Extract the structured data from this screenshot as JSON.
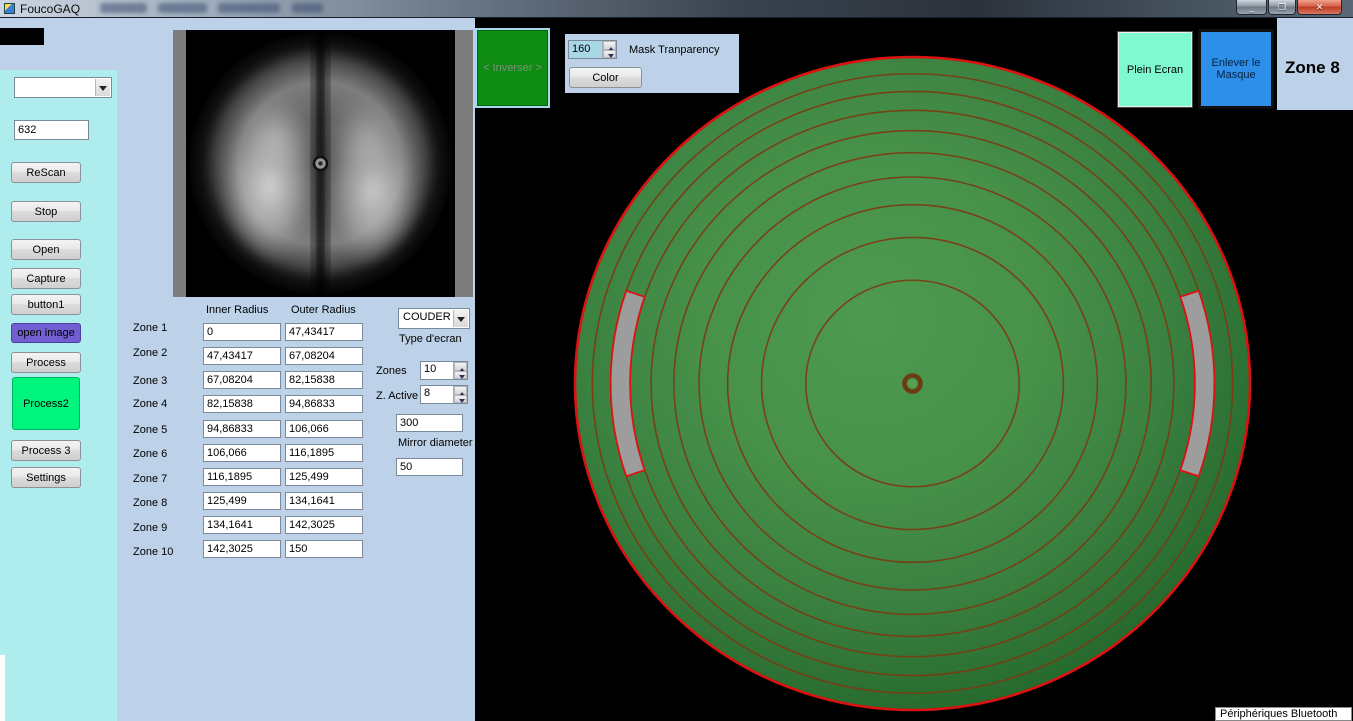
{
  "window": {
    "title": "FoucoGAQ",
    "controls": {
      "minimize": "_",
      "restore": "❐",
      "close": "✕"
    }
  },
  "sidebar": {
    "combo_value": "",
    "wavelength_value": "632",
    "buttons": [
      {
        "label": "ReScan"
      },
      {
        "label": "Stop"
      },
      {
        "label": "Open"
      },
      {
        "label": "Capture"
      },
      {
        "label": "button1"
      },
      {
        "label": "open image"
      },
      {
        "label": "Process"
      },
      {
        "label": "Process2"
      },
      {
        "label": "Process 3"
      },
      {
        "label": "Settings"
      }
    ]
  },
  "zones_table": {
    "headers": {
      "inner": "Inner Radius",
      "outer": "Outer Radius"
    },
    "rows": [
      {
        "label": "Zone 1",
        "inner": "0",
        "outer": "47,43417"
      },
      {
        "label": "Zone 2",
        "inner": "47,43417",
        "outer": "67,08204"
      },
      {
        "label": "Zone 3",
        "inner": "67,08204",
        "outer": "82,15838"
      },
      {
        "label": "Zone 4",
        "inner": "82,15838",
        "outer": "94,86833"
      },
      {
        "label": "Zone 5",
        "inner": "94,86833",
        "outer": "106,066"
      },
      {
        "label": "Zone 6",
        "inner": "106,066",
        "outer": "116,1895"
      },
      {
        "label": "Zone 7",
        "inner": "116,1895",
        "outer": "125,499"
      },
      {
        "label": "Zone 8",
        "inner": "125,499",
        "outer": "134,1641"
      },
      {
        "label": "Zone 9",
        "inner": "134,1641",
        "outer": "142,3025"
      },
      {
        "label": "Zone 10",
        "inner": "142,3025",
        "outer": "150"
      }
    ]
  },
  "screen_controls": {
    "screen_type_value": "COUDER",
    "screen_type_label": "Type d'ecran",
    "zones_label": "Zones",
    "zones_value": "10",
    "z_active_label": "Z. Active",
    "z_active_value": "8",
    "focal_value": "300",
    "mirror_diameter_label": "Mirror diameter",
    "mirror_diameter_value": "50"
  },
  "mask_controls": {
    "inverser_label": "< Inverser >",
    "transparency_value": "160",
    "transparency_label": "Mask Tranparency",
    "color_button_label": "Color"
  },
  "top_right": {
    "plein_ecran_label": "Plein Ecran",
    "enlever_label": "Enlever le Masque",
    "active_zone_label": "Zone 8"
  },
  "tooltip_text": "Périphériques Bluetooth",
  "colors": {
    "background": "#bdd2e8",
    "sidebar": "#aeeced",
    "mask_green": "#3f8a43",
    "ring_stroke": "#7c3a12",
    "rim_red": "#de1111",
    "zone_slot_gray": "#9d9d9d",
    "process2_green": "#00f57e",
    "open_image_purple": "#6f5fd0",
    "plein_ecran_mint": "#7ffad0",
    "enlever_blue": "#2d8fe9",
    "inverser_green": "#0e8c12"
  },
  "mirror_radius": 150
}
